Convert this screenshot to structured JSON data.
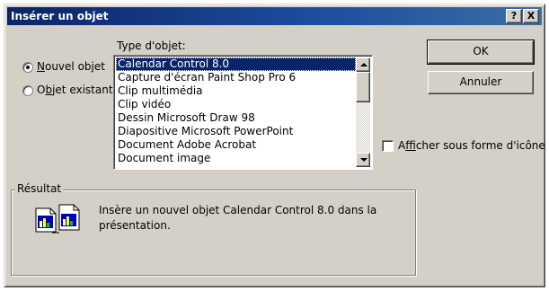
{
  "window": {
    "title": "Insérer un objet",
    "help_button": "?",
    "close_button": "X"
  },
  "options": {
    "new_object": {
      "label_pre": "",
      "label_u": "N",
      "label_post": "ouvel objet",
      "selected": true
    },
    "existing_object": {
      "label_pre": "O",
      "label_u": "b",
      "label_post": "jet existant",
      "selected": false
    }
  },
  "object_type": {
    "label": "Type d'objet:",
    "items": [
      "Calendar Control 8.0",
      "Capture d'écran Paint Shop Pro  6",
      "Clip multimédia",
      "Clip vidéo",
      "Dessin Microsoft Draw 98",
      "Diapositive Microsoft PowerPoint",
      "Document Adobe Acrobat",
      "Document image"
    ],
    "selected_index": 0
  },
  "buttons": {
    "ok": "OK",
    "cancel": "Annuler"
  },
  "display_as_icon": {
    "label_pre": "A",
    "label_u": "f",
    "label_post": "ficher sous forme d'icône",
    "checked": false
  },
  "result": {
    "title": "Résultat",
    "text": "Insère un nouvel objet Calendar Control 8.0 dans la présentation.",
    "icon": "insert-object-icon"
  }
}
